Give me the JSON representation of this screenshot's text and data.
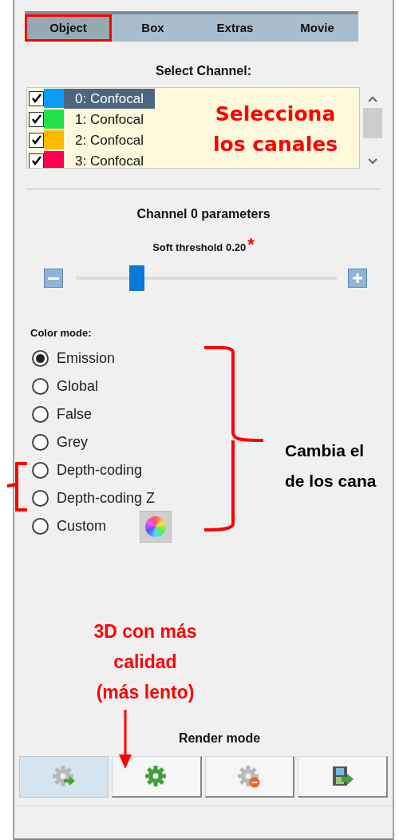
{
  "tabs": [
    {
      "label": "Object",
      "selected": true,
      "highlighted": true
    },
    {
      "label": "Box",
      "selected": false,
      "highlighted": false
    },
    {
      "label": "Extras",
      "selected": false,
      "highlighted": false
    },
    {
      "label": "Movie",
      "selected": false,
      "highlighted": false
    }
  ],
  "channel_list": {
    "title": "Select Channel:",
    "items": [
      {
        "label": "0: Confocal",
        "checked": true,
        "color": "#0b9bf2",
        "selected": true
      },
      {
        "label": "1: Confocal",
        "checked": true,
        "color": "#22e04a",
        "selected": false
      },
      {
        "label": "2: Confocal",
        "checked": true,
        "color": "#ffb900",
        "selected": false
      },
      {
        "label": "3: Confocal",
        "checked": true,
        "color": "#ff0050",
        "selected": false
      }
    ]
  },
  "parameters": {
    "title": "Channel 0 parameters",
    "slider": {
      "label": "Soft threshold 0.20",
      "marker": "*",
      "level": 0.21
    }
  },
  "color_mode": {
    "title": "Color mode:",
    "options": [
      {
        "label": "Emission",
        "selected": true
      },
      {
        "label": "Global",
        "selected": false
      },
      {
        "label": "False",
        "selected": false
      },
      {
        "label": "Grey",
        "selected": false
      },
      {
        "label": "Depth-coding",
        "selected": false
      },
      {
        "label": "Depth-coding Z",
        "selected": false
      },
      {
        "label": "Custom",
        "selected": false
      }
    ]
  },
  "render_mode": {
    "title": "Render mode",
    "buttons": [
      {
        "kind": "gear-arrow",
        "selected": true
      },
      {
        "kind": "gear",
        "selected": false
      },
      {
        "kind": "gear-minus",
        "selected": false
      },
      {
        "kind": "film-arrow",
        "selected": false
      }
    ]
  },
  "annotations": {
    "channel_note": [
      "Selecciona",
      "los canales"
    ],
    "color_note": [
      "Cambia el",
      "de los cana"
    ],
    "render_note": [
      "3D con más",
      "calidad",
      "(más lento)"
    ]
  }
}
